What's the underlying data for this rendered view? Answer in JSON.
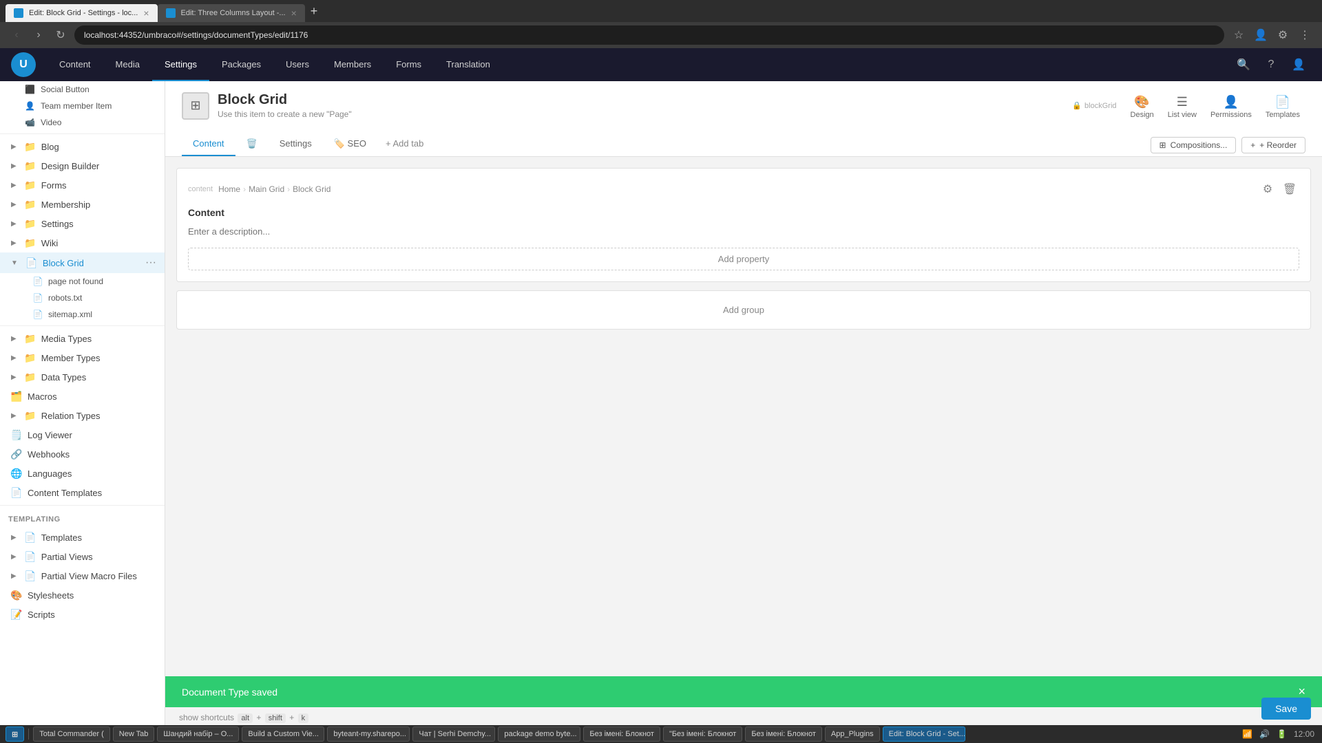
{
  "browser": {
    "tabs": [
      {
        "id": "tab1",
        "favicon_color": "#1a8ed1",
        "title": "Edit: Block Grid - Settings - loc...",
        "active": true
      },
      {
        "id": "tab2",
        "favicon_color": "#1a8ed1",
        "title": "Edit: Three Columns Layout -...",
        "active": false
      }
    ],
    "new_tab_label": "+",
    "address": "localhost:44352/umbraco#/settings/documentTypes/edit/1176",
    "nav_back": "‹",
    "nav_forward": "›",
    "nav_refresh": "↻"
  },
  "topnav": {
    "logo": "U",
    "items": [
      {
        "id": "content",
        "label": "Content",
        "active": false
      },
      {
        "id": "media",
        "label": "Media",
        "active": false
      },
      {
        "id": "settings",
        "label": "Settings",
        "active": true
      },
      {
        "id": "packages",
        "label": "Packages",
        "active": false
      },
      {
        "id": "users",
        "label": "Users",
        "active": false
      },
      {
        "id": "members",
        "label": "Members",
        "active": false
      },
      {
        "id": "forms",
        "label": "Forms",
        "active": false
      },
      {
        "id": "translation",
        "label": "Translation",
        "active": false
      }
    ],
    "icons": [
      "🔍",
      "?",
      "👤"
    ]
  },
  "sidebar": {
    "items_top": [
      {
        "id": "social-button",
        "icon": "⬛",
        "label": "Social Button",
        "indent": 2
      },
      {
        "id": "team-member-item",
        "icon": "👤",
        "label": "Team member Item",
        "indent": 2
      },
      {
        "id": "video",
        "icon": "📹",
        "label": "Video",
        "indent": 2
      },
      {
        "id": "blog",
        "icon": "📁",
        "label": "Blog",
        "indent": 1
      },
      {
        "id": "design-builder",
        "icon": "📁",
        "label": "Design Builder",
        "indent": 1
      },
      {
        "id": "forms-doc",
        "icon": "📁",
        "label": "Forms",
        "indent": 1
      },
      {
        "id": "membership",
        "icon": "📁",
        "label": "Membership",
        "indent": 1
      },
      {
        "id": "settings-doc",
        "icon": "📁",
        "label": "Settings",
        "indent": 1
      },
      {
        "id": "wiki",
        "icon": "📁",
        "label": "Wiki",
        "indent": 1
      },
      {
        "id": "block-grid",
        "icon": "📄",
        "label": "Block Grid",
        "indent": 1,
        "active": true
      },
      {
        "id": "page-not-found",
        "icon": "📄",
        "label": "page not found",
        "indent": 2
      },
      {
        "id": "robots-txt",
        "icon": "📄",
        "label": "robots.txt",
        "indent": 2
      },
      {
        "id": "sitemap-xml",
        "icon": "📄",
        "label": "sitemap.xml",
        "indent": 2
      }
    ],
    "items_mid": [
      {
        "id": "media-types",
        "icon": "📁",
        "label": "Media Types",
        "indent": 0
      },
      {
        "id": "member-types",
        "icon": "📁",
        "label": "Member Types",
        "indent": 0
      },
      {
        "id": "data-types",
        "icon": "📁",
        "label": "Data Types",
        "indent": 0
      },
      {
        "id": "macros",
        "icon": "🗂️",
        "label": "Macros",
        "indent": 0
      },
      {
        "id": "relation-types",
        "icon": "📁",
        "label": "Relation Types",
        "indent": 0
      },
      {
        "id": "log-viewer",
        "icon": "🗒️",
        "label": "Log Viewer",
        "indent": 0
      },
      {
        "id": "webhooks",
        "icon": "🔗",
        "label": "Webhooks",
        "indent": 0
      },
      {
        "id": "languages",
        "icon": "🌐",
        "label": "Languages",
        "indent": 0
      },
      {
        "id": "content-templates",
        "icon": "📄",
        "label": "Content Templates",
        "indent": 0
      }
    ],
    "section_templating": "Templating",
    "items_templating": [
      {
        "id": "templates",
        "icon": "📄",
        "label": "Templates",
        "indent": 0
      },
      {
        "id": "partial-views",
        "icon": "📄",
        "label": "Partial Views",
        "indent": 0
      },
      {
        "id": "partial-view-macro-files",
        "icon": "📄",
        "label": "Partial View Macro Files",
        "indent": 0
      },
      {
        "id": "stylesheets",
        "icon": "🎨",
        "label": "Stylesheets",
        "indent": 0
      },
      {
        "id": "scripts",
        "icon": "📝",
        "label": "Scripts",
        "indent": 0
      }
    ]
  },
  "doc": {
    "icon": "⊞",
    "title": "Block Grid",
    "subtitle": "Use this item to create a new \"Page\"",
    "alias": "blockGrid",
    "tabs": [
      {
        "id": "content",
        "label": "Content",
        "active": true
      },
      {
        "id": "trash",
        "label": "🗑️",
        "active": false
      },
      {
        "id": "settings",
        "label": "Settings",
        "active": false
      },
      {
        "id": "seo",
        "label": "SEO",
        "active": false
      },
      {
        "id": "add",
        "label": "+ Add tab",
        "active": false
      }
    ],
    "actions": [
      {
        "id": "design",
        "icon": "🎨",
        "label": "Design",
        "active": true
      },
      {
        "id": "list-view",
        "icon": "☰",
        "label": "List view",
        "active": false
      },
      {
        "id": "permissions",
        "icon": "👤",
        "label": "Permissions",
        "active": false
      },
      {
        "id": "templates",
        "icon": "📄",
        "label": "Templates",
        "active": false
      }
    ],
    "compositions_btn": "Compositions...",
    "reorder_btn": "+ Reorder",
    "content": {
      "group_label": "content",
      "breadcrumb": [
        "Home",
        "Main Grid",
        "Block Grid"
      ],
      "content_label": "Content",
      "description_placeholder": "Enter a description...",
      "add_property_label": "Add property",
      "add_group_label": "Add group"
    }
  },
  "toast": {
    "message": "Document Type saved",
    "close": "×"
  },
  "save_btn": "Save",
  "shortcuts": {
    "label": "show shortcuts",
    "keys": [
      "alt",
      "shift",
      "k"
    ]
  },
  "taskbar": {
    "items": [
      {
        "id": "total-commander",
        "label": "Total Commander (",
        "active": false
      },
      {
        "id": "new-tab",
        "label": "New Tab",
        "active": false
      },
      {
        "id": "shanidy-nabir",
        "label": "Шандий набір – О...",
        "active": false
      },
      {
        "id": "build-custom-view",
        "label": "Build a Custom Vie...",
        "active": false
      },
      {
        "id": "byteant-my-sharepoint",
        "label": "byteant-my.sharepo...",
        "active": false
      },
      {
        "id": "chat-serhi",
        "label": "Чат | Serhi Demchy...",
        "active": false
      },
      {
        "id": "package-demo",
        "label": "package demo byte...",
        "active": false
      },
      {
        "id": "bez-imeni-blocknot1",
        "label": "Без імені: Блокнот",
        "active": false
      },
      {
        "id": "bez-imeni-blocknot2",
        "label": "\"Без імені: Блокнот",
        "active": false
      },
      {
        "id": "bez-imeni-blocknot3",
        "label": "Без імені: Блокнот",
        "active": false
      },
      {
        "id": "app-plugins",
        "label": "App_Plugins",
        "active": false
      },
      {
        "id": "edit-block-grid",
        "label": "Edit: Block Grid - Set...",
        "active": true
      }
    ]
  }
}
